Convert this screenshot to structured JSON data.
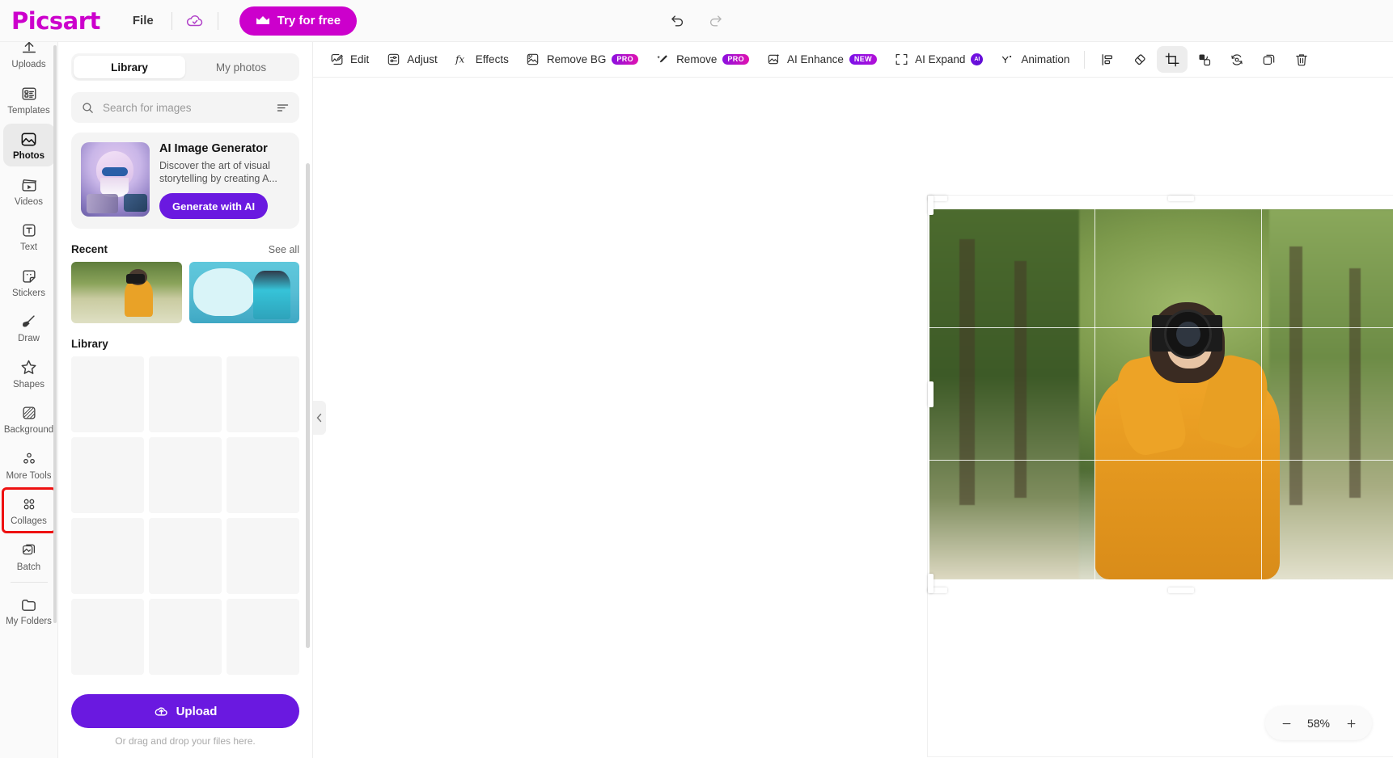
{
  "header": {
    "logo": "Picsart",
    "file_label": "File",
    "cloud_icon": "cloud-check-icon",
    "try_free_label": "Try for free",
    "try_free_icon": "crown-icon",
    "undo_icon": "undo-arrow-icon",
    "redo_icon": "redo-arrow-icon",
    "brand_color": "#cc00cc"
  },
  "rail": {
    "items": [
      {
        "label": "Uploads",
        "icon": "upload-icon",
        "active": false,
        "marked": false
      },
      {
        "label": "Templates",
        "icon": "templates-icon",
        "active": false,
        "marked": false
      },
      {
        "label": "Photos",
        "icon": "photos-icon",
        "active": true,
        "marked": false
      },
      {
        "label": "Videos",
        "icon": "video-clapper-icon",
        "active": false,
        "marked": false
      },
      {
        "label": "Text",
        "icon": "text-t-icon",
        "active": false,
        "marked": false
      },
      {
        "label": "Stickers",
        "icon": "sticker-icon",
        "active": false,
        "marked": false
      },
      {
        "label": "Draw",
        "icon": "brush-icon",
        "active": false,
        "marked": false
      },
      {
        "label": "Shapes",
        "icon": "star-shape-icon",
        "active": false,
        "marked": false
      },
      {
        "label": "Background",
        "icon": "background-pattern-icon",
        "active": false,
        "marked": false
      },
      {
        "label": "More Tools",
        "icon": "more-tools-icon",
        "active": false,
        "marked": false
      },
      {
        "label": "Collages",
        "icon": "collages-grid-icon",
        "active": false,
        "marked": true
      },
      {
        "label": "Batch",
        "icon": "batch-icon",
        "active": false,
        "marked": false
      }
    ],
    "footer_item": {
      "label": "My Folders",
      "icon": "folder-icon"
    },
    "marker_color": "#ee1111"
  },
  "panel": {
    "tabs": [
      {
        "label": "Library",
        "active": true
      },
      {
        "label": "My photos",
        "active": false
      }
    ],
    "search": {
      "placeholder": "Search for images",
      "value": "",
      "search_icon": "search-icon",
      "filter_icon": "filter-icon"
    },
    "ai_card": {
      "title": "AI Image Generator",
      "description": "Discover the art of visual storytelling by creating A...",
      "button_label": "Generate with AI",
      "button_color": "#6a19e0"
    },
    "recent": {
      "title": "Recent",
      "see_all": "See all",
      "items": [
        {
          "alt": "woman-with-camera-thumbnail"
        },
        {
          "alt": "woman-in-blue-clouds-thumbnail"
        }
      ]
    },
    "library": {
      "title": "Library",
      "placeholder_count": 18
    },
    "upload": {
      "label": "Upload",
      "icon": "upload-cloud-icon",
      "hint": "Or drag and drop your files here.",
      "color": "#6a19e0"
    }
  },
  "toolbar": {
    "items": [
      {
        "label": "Edit",
        "icon": "edit-image-icon",
        "badge": "",
        "active": false
      },
      {
        "label": "Adjust",
        "icon": "adjust-sliders-icon",
        "badge": "",
        "active": false
      },
      {
        "label": "Effects",
        "icon": "fx-effects-icon",
        "badge": "",
        "active": false
      },
      {
        "label": "Remove BG",
        "icon": "remove-bg-icon",
        "badge": "PRO",
        "active": false
      },
      {
        "label": "Remove",
        "icon": "magic-remove-icon",
        "badge": "PRO",
        "active": false
      },
      {
        "label": "AI Enhance",
        "icon": "ai-enhance-icon",
        "badge": "NEW",
        "active": false
      },
      {
        "label": "AI Expand",
        "icon": "ai-expand-icon",
        "badge": "AI",
        "active": false
      },
      {
        "label": "Animation",
        "icon": "animation-wand-icon",
        "badge": "",
        "active": false
      }
    ],
    "icon_buttons": [
      {
        "icon": "align-icon",
        "active": false
      },
      {
        "icon": "eraser-icon",
        "active": false
      },
      {
        "icon": "crop-icon",
        "active": true
      },
      {
        "icon": "flip-icon",
        "active": false
      },
      {
        "icon": "rotate-icon",
        "active": false
      },
      {
        "icon": "duplicate-icon",
        "active": false
      },
      {
        "icon": "delete-trash-icon",
        "active": false
      }
    ],
    "pro_badge_gradient": "#8a10e0 to #e012b0"
  },
  "canvas": {
    "collapse_left_icon": "chevron-left-icon",
    "collapse_right_icon": "chevron-right-icon",
    "image_alt": "woman-photographing-with-camera-in-tree-lined-park",
    "crop_overlay": "rule-of-thirds-grid"
  },
  "zoom": {
    "value": "58%",
    "minus_icon": "minus-icon",
    "plus_icon": "plus-icon"
  }
}
